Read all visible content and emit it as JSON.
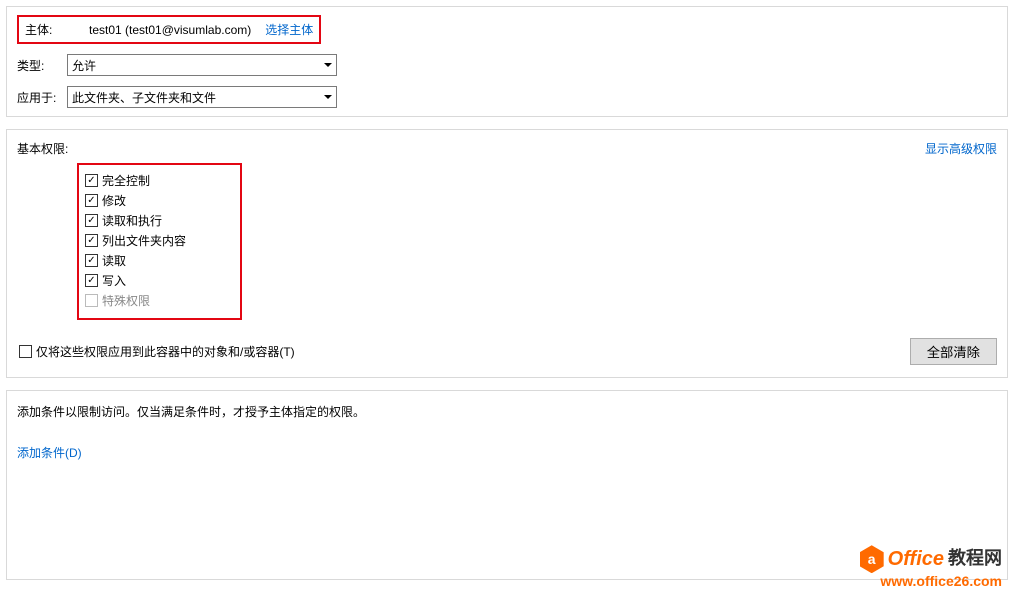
{
  "header": {
    "principal_label": "主体:",
    "principal_value": "test01 (test01@visumlab.com)",
    "select_principal": "选择主体",
    "type_label": "类型:",
    "type_value": "允许",
    "applies_to_label": "应用于:",
    "applies_to_value": "此文件夹、子文件夹和文件"
  },
  "permissions": {
    "title": "基本权限:",
    "show_advanced": "显示高级权限",
    "items": [
      {
        "label": "完全控制",
        "checked": true,
        "enabled": true
      },
      {
        "label": "修改",
        "checked": true,
        "enabled": true
      },
      {
        "label": "读取和执行",
        "checked": true,
        "enabled": true
      },
      {
        "label": "列出文件夹内容",
        "checked": true,
        "enabled": true
      },
      {
        "label": "读取",
        "checked": true,
        "enabled": true
      },
      {
        "label": "写入",
        "checked": true,
        "enabled": true
      },
      {
        "label": "特殊权限",
        "checked": false,
        "enabled": false
      }
    ],
    "apply_only_label": "仅将这些权限应用到此容器中的对象和/或容器(T)",
    "clear_all": "全部清除"
  },
  "conditions": {
    "desc": "添加条件以限制访问。仅当满足条件时，才授予主体指定的权限。",
    "add_link": "添加条件(D)"
  },
  "watermark": {
    "brand": "Office",
    "cn": "教程网",
    "url": "www.office26.com",
    "icon_letter": "a"
  }
}
